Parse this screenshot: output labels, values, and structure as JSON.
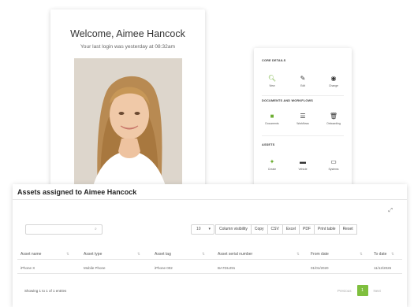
{
  "welcome": {
    "title": "Welcome, Aimee Hancock",
    "subtitle": "Your last login was yesterday at 08:32am"
  },
  "actions": {
    "core_details": {
      "title": "CORE DETAILS",
      "items": [
        {
          "icon": "search-icon",
          "label": "View"
        },
        {
          "icon": "pencil-icon",
          "label": "Edit"
        },
        {
          "icon": "eye-icon",
          "label": "Change"
        }
      ]
    },
    "documents": {
      "title": "DOCUMENTS AND WORKFLOWS",
      "items": [
        {
          "icon": "document-icon",
          "label": "Documents"
        },
        {
          "icon": "list-icon",
          "label": "Workflows"
        },
        {
          "icon": "trash-icon",
          "label": "Onboarding"
        }
      ]
    },
    "assets": {
      "title": "ASSETS",
      "items": [
        {
          "icon": "tag-icon",
          "label": "Create"
        },
        {
          "icon": "car-icon",
          "label": "Vehicle"
        },
        {
          "icon": "laptop-icon",
          "label": "Systems"
        }
      ]
    },
    "colors": {
      "accent_green": "#6cad31",
      "accent_yellow": "#e8c84a"
    }
  },
  "assets_table": {
    "title": "Assets assigned to Aimee Hancock",
    "search_placeholder": "",
    "length_value": "10",
    "buttons": [
      "Column visibility",
      "Copy",
      "CSV",
      "Excel",
      "PDF",
      "Print table",
      "Reset"
    ],
    "columns": [
      "Asset name",
      "Asset type",
      "Asset tag",
      "Asset serial number",
      "From date",
      "To date"
    ],
    "rows": [
      [
        "iPhone X",
        "Mobile Phone",
        "iPhone 002",
        "BA7DUJ91",
        "01/01/2020",
        "11/12/2026"
      ]
    ],
    "showing": "Showing 1 to 1 of 1 entries",
    "pagination": {
      "previous": "Previous",
      "current": "1",
      "next": "Next"
    },
    "colors": {
      "pager_active": "#7fbf3e"
    }
  }
}
